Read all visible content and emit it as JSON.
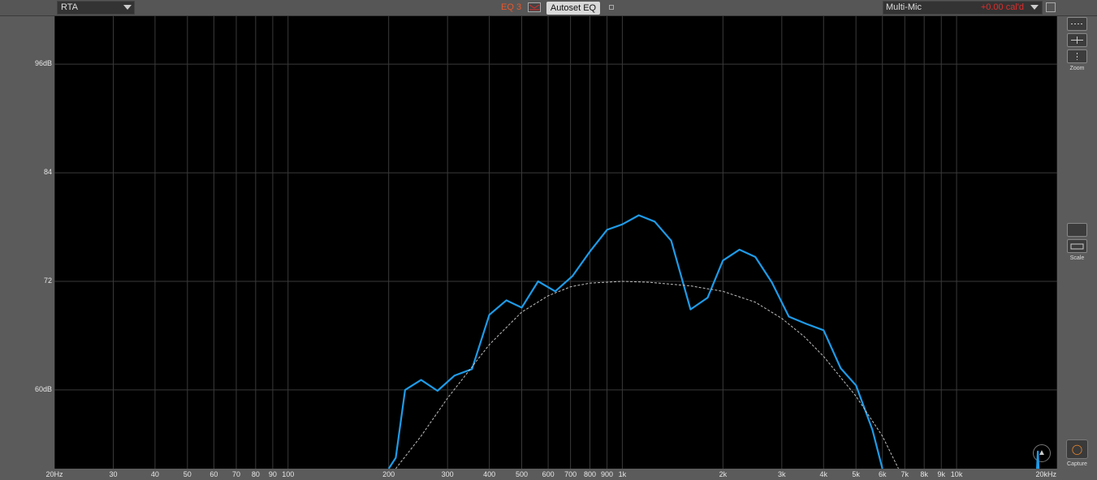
{
  "toolbar": {
    "mode": "RTA",
    "eq_label": "EQ 3",
    "autoset_label": "Autoset EQ",
    "mic_label": "Multi-Mic",
    "mic_cal": "+0.00 cal'd"
  },
  "right_panel": {
    "zoom_label": "Zoom",
    "scale_label": "Scale",
    "capture_label": "Capture"
  },
  "colors": {
    "series_primary": "#1e9be8",
    "target_curve": "#bfbfbf",
    "grid": "#3a3a3a",
    "plot_background": "#000000",
    "eq_accent": "#e8572b",
    "cal_accent": "#e02c2c",
    "capture_accent": "#f08a2c"
  },
  "chart_data": {
    "type": "line",
    "x_scale": "log",
    "xlim": [
      20,
      20000
    ],
    "ylim": [
      51.3,
      101.3
    ],
    "y_ticks": [
      {
        "value": 96,
        "label": "96dB"
      },
      {
        "value": 84,
        "label": "84"
      },
      {
        "value": 72,
        "label": "72"
      },
      {
        "value": 60,
        "label": "60dB"
      }
    ],
    "x_ticks": [
      {
        "value": 20,
        "label": "20Hz"
      },
      {
        "value": 30,
        "label": "30"
      },
      {
        "value": 40,
        "label": "40"
      },
      {
        "value": 50,
        "label": "50"
      },
      {
        "value": 60,
        "label": "60"
      },
      {
        "value": 70,
        "label": "70"
      },
      {
        "value": 80,
        "label": "80"
      },
      {
        "value": 90,
        "label": "90"
      },
      {
        "value": 100,
        "label": "100"
      },
      {
        "value": 200,
        "label": "200"
      },
      {
        "value": 300,
        "label": "300"
      },
      {
        "value": 400,
        "label": "400"
      },
      {
        "value": 500,
        "label": "500"
      },
      {
        "value": 600,
        "label": "600"
      },
      {
        "value": 700,
        "label": "700"
      },
      {
        "value": 800,
        "label": "800"
      },
      {
        "value": 900,
        "label": "900"
      },
      {
        "value": 1000,
        "label": "1k"
      },
      {
        "value": 2000,
        "label": "2k"
      },
      {
        "value": 3000,
        "label": "3k"
      },
      {
        "value": 4000,
        "label": "4k"
      },
      {
        "value": 5000,
        "label": "5k"
      },
      {
        "value": 6000,
        "label": "6k"
      },
      {
        "value": 7000,
        "label": "7k"
      },
      {
        "value": 8000,
        "label": "8k"
      },
      {
        "value": 9000,
        "label": "9k"
      },
      {
        "value": 10000,
        "label": "10k"
      },
      {
        "value": 20000,
        "label": "20kHz"
      }
    ],
    "series": [
      {
        "points": [
          [
            200,
            51.3
          ],
          [
            210,
            52.5
          ],
          [
            224,
            60.0
          ],
          [
            250,
            61.1
          ],
          [
            280,
            59.9
          ],
          [
            315,
            61.6
          ],
          [
            355,
            62.3
          ],
          [
            400,
            68.3
          ],
          [
            450,
            69.9
          ],
          [
            500,
            69.1
          ],
          [
            560,
            72.0
          ],
          [
            630,
            70.9
          ],
          [
            710,
            72.6
          ],
          [
            800,
            75.3
          ],
          [
            900,
            77.7
          ],
          [
            1000,
            78.3
          ],
          [
            1120,
            79.3
          ],
          [
            1250,
            78.6
          ],
          [
            1400,
            76.5
          ],
          [
            1600,
            68.9
          ],
          [
            1800,
            70.2
          ],
          [
            2000,
            74.3
          ],
          [
            2240,
            75.5
          ],
          [
            2500,
            74.7
          ],
          [
            2800,
            71.9
          ],
          [
            3150,
            68.1
          ],
          [
            3550,
            67.3
          ],
          [
            4000,
            66.6
          ],
          [
            4500,
            62.4
          ],
          [
            5000,
            60.5
          ],
          [
            5600,
            55.6
          ],
          [
            6000,
            51.3
          ]
        ]
      },
      {
        "style": "dashed",
        "points": [
          [
            210,
            51.3
          ],
          [
            250,
            54.9
          ],
          [
            300,
            59.1
          ],
          [
            400,
            65.0
          ],
          [
            500,
            68.6
          ],
          [
            600,
            70.4
          ],
          [
            700,
            71.4
          ],
          [
            800,
            71.8
          ],
          [
            1000,
            72.0
          ],
          [
            1200,
            71.9
          ],
          [
            1600,
            71.5
          ],
          [
            2000,
            70.9
          ],
          [
            2500,
            69.7
          ],
          [
            3000,
            67.9
          ],
          [
            3500,
            65.9
          ],
          [
            4000,
            63.7
          ],
          [
            5000,
            59.3
          ],
          [
            6000,
            54.9
          ],
          [
            6700,
            51.3
          ]
        ]
      },
      {
        "points": [
          [
            17400,
            51.3
          ],
          [
            17500,
            53.2
          ],
          [
            17600,
            51.3
          ]
        ]
      }
    ]
  }
}
